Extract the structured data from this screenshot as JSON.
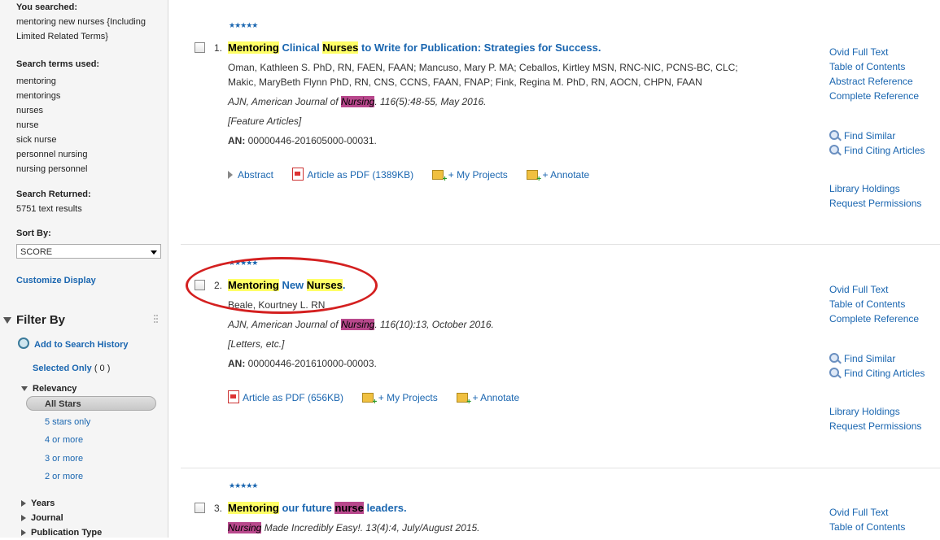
{
  "sidebar": {
    "you_searched_label": "You searched:",
    "you_searched_value": "mentoring new nurses {Including Limited Related Terms}",
    "search_terms_label": "Search terms used:",
    "search_terms": [
      "mentoring",
      "mentorings",
      "nurses",
      "nurse",
      "sick nurse",
      "personnel nursing",
      "nursing personnel"
    ],
    "returned_label": "Search Returned:",
    "returned_value": "5751 text results",
    "sort_label": "Sort By:",
    "sort_value": "SCORE",
    "customize_label": "Customize Display",
    "filter_title": "Filter By",
    "add_history_label": "Add to Search History",
    "selected_only_label": "Selected Only",
    "selected_only_count": "( 0 )",
    "relevancy_label": "Relevancy",
    "all_stars_label": "All Stars",
    "relevancy_options": [
      "5 stars only",
      "4 or more",
      "3 or more",
      "2 or more"
    ],
    "facets": [
      "Years",
      "Journal",
      "Publication Type"
    ]
  },
  "results": [
    {
      "stars": "★★★★★",
      "number": "1.",
      "title_parts": [
        {
          "text": "Mentoring",
          "hl": "y"
        },
        {
          "text": " Clinical ",
          "hl": ""
        },
        {
          "text": "Nurses",
          "hl": "y"
        },
        {
          "text": " to Write for Publication: Strategies for Success.",
          "hl": ""
        }
      ],
      "authors": "Oman, Kathleen S. PhD, RN, FAEN, FAAN; Mancuso, Mary P. MA; Ceballos, Kirtley MSN, RNC-NIC, PCNS-BC, CLC; Makic, MaryBeth Flynn PhD, RN, CNS, CCNS, FAAN, FNAP; Fink, Regina M. PhD, RN, AOCN, CHPN, FAAN",
      "source_pre": "AJN, American Journal of ",
      "source_hl": "Nursing",
      "source_post": ". 116(5):48-55, May 2016.",
      "category": "[Feature Articles]",
      "an_label": "AN:",
      "an_value": "00000446-201605000-00031.",
      "abstract_label": "Abstract",
      "pdf_label": "Article as PDF (1389KB)",
      "projects_label": "+ My Projects",
      "annotate_label": "+ Annotate",
      "links": [
        "Ovid Full Text",
        "Table of Contents",
        "Abstract Reference",
        "Complete Reference"
      ],
      "find_similar": "Find Similar",
      "find_citing": "Find Citing Articles",
      "library_holdings": "Library Holdings",
      "request_permissions": "Request Permissions"
    },
    {
      "stars": "★★★★★",
      "number": "2.",
      "title_parts": [
        {
          "text": "Mentoring",
          "hl": "y"
        },
        {
          "text": " New ",
          "hl": ""
        },
        {
          "text": "Nurses",
          "hl": "y"
        },
        {
          "text": ".",
          "hl": ""
        }
      ],
      "authors": "Beale, Kourtney L. RN",
      "source_pre": "AJN, American Journal of ",
      "source_hl": "Nursing",
      "source_post": ". 116(10):13, October 2016.",
      "category": "[Letters, etc.]",
      "an_label": "AN:",
      "an_value": "00000446-201610000-00003.",
      "pdf_label": "Article as PDF (656KB)",
      "projects_label": "+ My Projects",
      "annotate_label": "+ Annotate",
      "links": [
        "Ovid Full Text",
        "Table of Contents",
        "Complete Reference"
      ],
      "find_similar": "Find Similar",
      "find_citing": "Find Citing Articles",
      "library_holdings": "Library Holdings",
      "request_permissions": "Request Permissions"
    },
    {
      "stars": "★★★★★",
      "number": "3.",
      "title_parts": [
        {
          "text": "Mentoring",
          "hl": "y"
        },
        {
          "text": " our future ",
          "hl": ""
        },
        {
          "text": "nurse",
          "hl": "p"
        },
        {
          "text": " leaders.",
          "hl": ""
        }
      ],
      "source_hl": "Nursing",
      "source_post": " Made Incredibly Easy!. 13(4):4, July/August 2015.",
      "links": [
        "Ovid Full Text",
        "Table of Contents"
      ]
    }
  ]
}
